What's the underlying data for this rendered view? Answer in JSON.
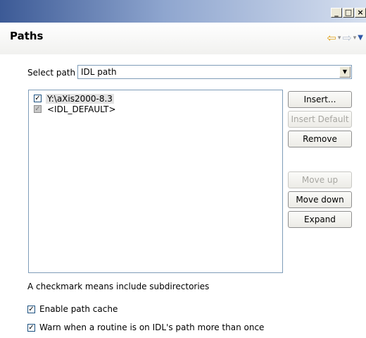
{
  "window": {
    "minimize_label": "_",
    "maximize_label": "□",
    "close_label": "×"
  },
  "header": {
    "title": "Paths",
    "icons": [
      "back-arrow-icon",
      "dropdown-caret-icon",
      "forward-arrow-icon",
      "dropdown-caret-icon",
      "view-menu-icon"
    ]
  },
  "select_path": {
    "label": "Select path",
    "value": "IDL path"
  },
  "path_list": {
    "items": [
      {
        "label": "Y:\\aXis2000-8.3",
        "checked": true,
        "selected": true
      },
      {
        "label": "<IDL_DEFAULT>",
        "checked": true,
        "disabled": true
      }
    ]
  },
  "buttons": {
    "insert": "Insert...",
    "insert_default": "Insert Default",
    "remove": "Remove",
    "move_up": "Move up",
    "move_down": "Move down",
    "expand": "Expand"
  },
  "hint": "A checkmark means include subdirectories",
  "options": {
    "enable_cache": {
      "label": "Enable path cache",
      "checked": true
    },
    "warn_duplicate": {
      "label": "Warn when a routine is on IDL's path more than once",
      "checked": true
    }
  },
  "colors": {
    "titlebar_start": "#3c5a96",
    "back_arrow": "#e0a21a",
    "disabled_text": "#a7a6a1",
    "field_border": "#7f9db9"
  }
}
